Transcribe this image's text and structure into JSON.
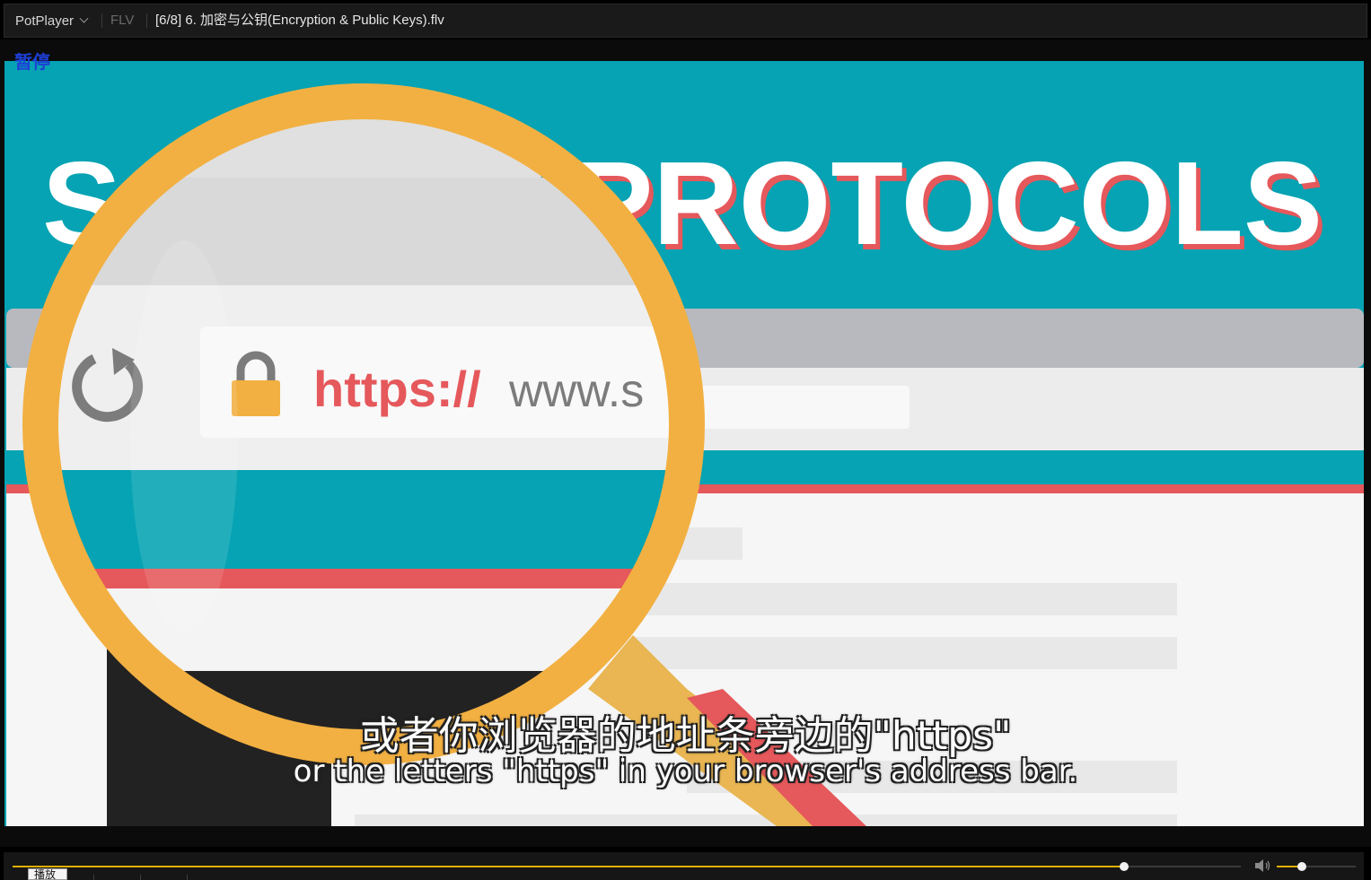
{
  "titlebar": {
    "app_name": "PotPlayer",
    "format": "FLV",
    "file_title": "[6/8] 6. 加密与公钥(Encryption & Public Keys).flv"
  },
  "osd": {
    "status": "暂停"
  },
  "video_text": {
    "banner_visible": "PROTOCOLS",
    "url_https": "https://",
    "url_rest": "www.s"
  },
  "subtitles": {
    "zh": "或者你浏览器的地址条旁边的\"https\"",
    "en": "or the letters \"https\" in your browser's address bar."
  },
  "controls": {
    "seek_progress": 0.905,
    "volume_level": 0.32,
    "tooltip": "播放"
  },
  "colors": {
    "video_bg": "#05a3b3",
    "magnifier": "#f2b042",
    "https_red": "#e5585b",
    "accent_yellow": "#e0b000"
  }
}
